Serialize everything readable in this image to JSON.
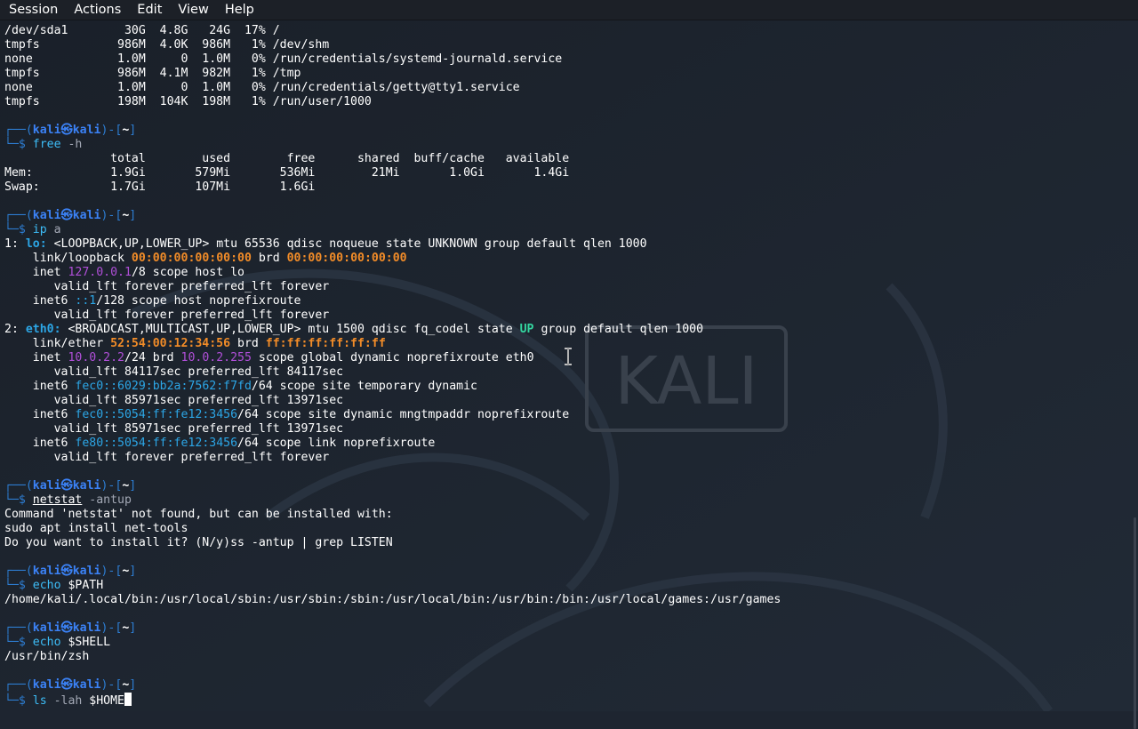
{
  "menubar": {
    "items": [
      "Session",
      "Actions",
      "Edit",
      "View",
      "Help"
    ]
  },
  "prompt": {
    "user": "kali",
    "at": "㉿",
    "host": "kali",
    "dir": "~",
    "top_left": "┌──(",
    "mid": ")-[",
    "end": "]",
    "bottom_left": "└─$ "
  },
  "df_rows": [
    "/dev/sda1        30G  4.8G   24G  17% /",
    "tmpfs           986M  4.0K  986M   1% /dev/shm",
    "none            1.0M     0  1.0M   0% /run/credentials/systemd-journald.service",
    "tmpfs           986M  4.1M  982M   1% /tmp",
    "none            1.0M     0  1.0M   0% /run/credentials/getty@tty1.service",
    "tmpfs           198M  104K  198M   1% /run/user/1000"
  ],
  "cmd_free": {
    "cmd": "free",
    "args": " -h"
  },
  "free_output": [
    "               total        used        free      shared  buff/cache   available",
    "Mem:           1.9Gi       579Mi       536Mi        21Mi       1.0Gi       1.4Gi",
    "Swap:          1.7Gi       107Mi       1.6Gi"
  ],
  "cmd_ip": {
    "cmd": "ip",
    "args": " a"
  },
  "ip": {
    "lo": {
      "idx": "1: ",
      "name": "lo:",
      "flags": " <LOOPBACK,UP,LOWER_UP> mtu 65536 qdisc noqueue state UNKNOWN group default qlen 1000",
      "link_prefix": "    link/loopback ",
      "mac": "00:00:00:00:00:00",
      "brd_label": " brd ",
      "brd_mac": "00:00:00:00:00:00",
      "inet_prefix": "    inet ",
      "inet_addr": "127.0.0.1",
      "inet_suffix": "/8 scope host lo",
      "inet_lft": "       valid_lft forever preferred_lft forever",
      "inet6_prefix": "    inet6 ",
      "inet6_addr": "::1",
      "inet6_suffix": "/128 scope host noprefixroute",
      "inet6_lft": "       valid_lft forever preferred_lft forever"
    },
    "eth0": {
      "idx": "2: ",
      "name": "eth0:",
      "flags_a": " <BROADCAST,MULTICAST,UP,LOWER_UP> mtu 1500 qdisc fq_codel state ",
      "state": "UP",
      "flags_b": " group default qlen 1000",
      "link_prefix": "    link/ether ",
      "mac": "52:54:00:12:34:56",
      "brd_label": " brd ",
      "brd_mac": "ff:ff:ff:ff:ff:ff",
      "inet_prefix": "    inet ",
      "inet_addr": "10.0.2.2",
      "inet_mid": "/24 brd ",
      "inet_brd": "10.0.2.255",
      "inet_suffix": " scope global dynamic noprefixroute eth0",
      "inet_lft": "       valid_lft 84117sec preferred_lft 84117sec",
      "inet6_1_prefix": "    inet6 ",
      "inet6_1_addr": "fec0::6029:bb2a:7562:f7fd",
      "inet6_1_suffix": "/64 scope site temporary dynamic",
      "inet6_1_lft": "       valid_lft 85971sec preferred_lft 13971sec",
      "inet6_2_prefix": "    inet6 ",
      "inet6_2_addr": "fec0::5054:ff:fe12:3456",
      "inet6_2_suffix": "/64 scope site dynamic mngtmpaddr noprefixroute",
      "inet6_2_lft": "       valid_lft 85971sec preferred_lft 13971sec",
      "inet6_3_prefix": "    inet6 ",
      "inet6_3_addr": "fe80::5054:ff:fe12:3456",
      "inet6_3_suffix": "/64 scope link noprefixroute",
      "inet6_3_lft": "       valid_lft forever preferred_lft forever"
    }
  },
  "cmd_netstat": {
    "cmd": "netstat",
    "args": " -antup"
  },
  "netstat_output": [
    "Command 'netstat' not found, but can be installed with:",
    "sudo apt install net-tools",
    "Do you want to install it? (N/y)ss -antup | grep LISTEN"
  ],
  "cmd_path": {
    "cmd": "echo",
    "args": " $PATH"
  },
  "path_output": "/home/kali/.local/bin:/usr/local/sbin:/usr/sbin:/sbin:/usr/local/bin:/usr/bin:/bin:/usr/local/games:/usr/games",
  "cmd_shell": {
    "cmd": "echo",
    "args": " $SHELL"
  },
  "shell_output": "/usr/bin/zsh",
  "cmd_current": {
    "cmd": "ls",
    "args": " -lah",
    "var": " $HOME"
  },
  "wallpaper": {
    "logo_text": "KALI"
  },
  "icons": [
    "i-beam-cursor-icon",
    "block-cursor-icon",
    "kali-dragon-watermark-icon"
  ],
  "colors": {
    "background": "#1e2530",
    "menubar": "#1c2027",
    "prompt_frame": "#2d7dd2",
    "prompt_user": "#3b82f6",
    "command": "#3dbcf6",
    "mac": "#f28c28",
    "ipv4": "#b04fd8",
    "ipv6": "#2ca6e6",
    "state_up": "#34d6a0"
  }
}
